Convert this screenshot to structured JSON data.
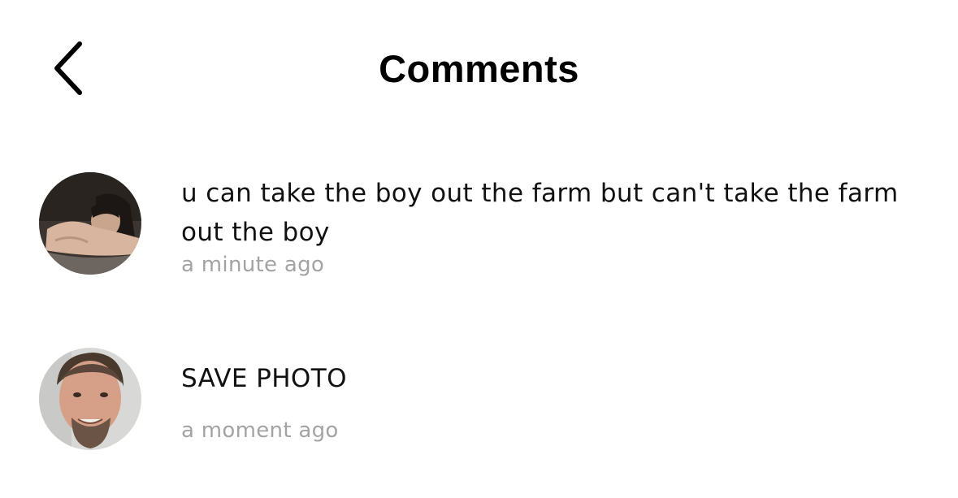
{
  "header": {
    "title": "Comments",
    "back_icon": "chevron-left-icon"
  },
  "comments": [
    {
      "avatar": "user-avatar-photo",
      "text": "u can take the boy out the farm but can't take the farm out the boy",
      "time": "a minute ago"
    },
    {
      "avatar": "user-avatar-photo",
      "text": "SAVE PHOTO",
      "time": "a moment ago"
    }
  ],
  "colors": {
    "background": "#ffffff",
    "text": "#111111",
    "timestamp": "#a3a3a3"
  }
}
